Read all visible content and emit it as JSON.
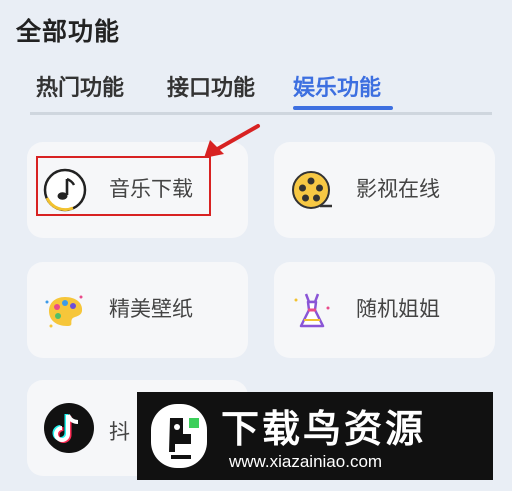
{
  "section": {
    "title": "全部功能"
  },
  "tabs": [
    {
      "label": "热门功能",
      "active": false
    },
    {
      "label": "接口功能",
      "active": false
    },
    {
      "label": "娱乐功能",
      "active": true
    }
  ],
  "colors": {
    "accent": "#3d6fe0",
    "highlight": "#d82222",
    "background": "#e9eef5"
  },
  "cards": [
    {
      "label": "音乐下载",
      "icon": "music-note-icon"
    },
    {
      "label": "影视在线",
      "icon": "film-reel-icon"
    },
    {
      "label": "精美壁纸",
      "icon": "palette-icon"
    },
    {
      "label": "随机姐姐",
      "icon": "dress-icon"
    },
    {
      "label": "抖",
      "icon": "tiktok-icon"
    }
  ],
  "watermark": {
    "brand": "下载鸟资源",
    "url": "www.xiazainiao.com"
  }
}
